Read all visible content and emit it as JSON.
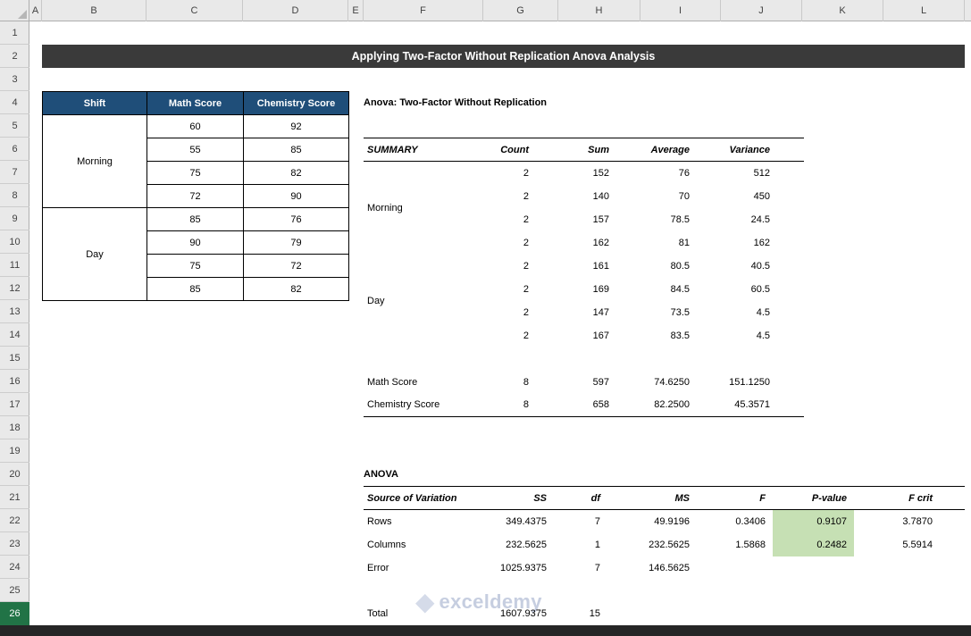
{
  "grid": {
    "columns": [
      "A",
      "B",
      "C",
      "D",
      "E",
      "F",
      "G",
      "H",
      "I",
      "J",
      "K",
      "L"
    ],
    "rows": [
      "1",
      "2",
      "3",
      "4",
      "5",
      "6",
      "7",
      "8",
      "9",
      "10",
      "11",
      "12",
      "13",
      "14",
      "15",
      "16",
      "17",
      "18",
      "19",
      "20",
      "21",
      "22",
      "23",
      "24",
      "25",
      "26"
    ]
  },
  "banner": {
    "title": "Applying Two-Factor Without Replication Anova Analysis"
  },
  "scores": {
    "headers": [
      "Shift",
      "Math Score",
      "Chemistry Score"
    ],
    "groups": [
      {
        "label": "Morning"
      },
      {
        "label": "Day"
      }
    ],
    "math": [
      "60",
      "55",
      "75",
      "72",
      "85",
      "90",
      "75",
      "85"
    ],
    "chemistry": [
      "92",
      "85",
      "82",
      "90",
      "76",
      "79",
      "72",
      "82"
    ]
  },
  "summary": {
    "title": "Anova: Two-Factor Without Replication",
    "headers": [
      "SUMMARY",
      "Count",
      "Sum",
      "Average",
      "Variance"
    ],
    "groups": [
      {
        "label": "Morning"
      },
      {
        "label": "Day"
      }
    ],
    "rows": [
      [
        "2",
        "152",
        "76",
        "512"
      ],
      [
        "2",
        "140",
        "70",
        "450"
      ],
      [
        "2",
        "157",
        "78.5",
        "24.5"
      ],
      [
        "2",
        "162",
        "81",
        "162"
      ],
      [
        "2",
        "161",
        "80.5",
        "40.5"
      ],
      [
        "2",
        "169",
        "84.5",
        "60.5"
      ],
      [
        "2",
        "147",
        "73.5",
        "4.5"
      ],
      [
        "2",
        "167",
        "83.5",
        "4.5"
      ]
    ],
    "totals": [
      {
        "label": "Math Score",
        "count": "8",
        "sum": "597",
        "average": "74.6250",
        "variance": "151.1250"
      },
      {
        "label": "Chemistry Score",
        "count": "8",
        "sum": "658",
        "average": "82.2500",
        "variance": "45.3571"
      }
    ]
  },
  "anova": {
    "title": "ANOVA",
    "headers": [
      "Source of Variation",
      "SS",
      "df",
      "MS",
      "F",
      "P-value",
      "F crit"
    ],
    "rows": [
      {
        "source": "Rows",
        "ss": "349.4375",
        "df": "7",
        "ms": "49.9196",
        "f": "0.3406",
        "p": "0.9107",
        "fcrit": "3.7870"
      },
      {
        "source": "Columns",
        "ss": "232.5625",
        "df": "1",
        "ms": "232.5625",
        "f": "1.5868",
        "p": "0.2482",
        "fcrit": "5.5914"
      },
      {
        "source": "Error",
        "ss": "1025.9375",
        "df": "7",
        "ms": "146.5625",
        "f": "",
        "p": "",
        "fcrit": ""
      }
    ],
    "total": {
      "source": "Total",
      "ss": "1607.9375",
      "df": "15"
    }
  },
  "watermark": {
    "text": "exceldemy"
  },
  "colors": {
    "header_blue": "#1F4E79",
    "banner_dark": "#3A3A3A",
    "highlight_green": "#C6E0B4"
  }
}
